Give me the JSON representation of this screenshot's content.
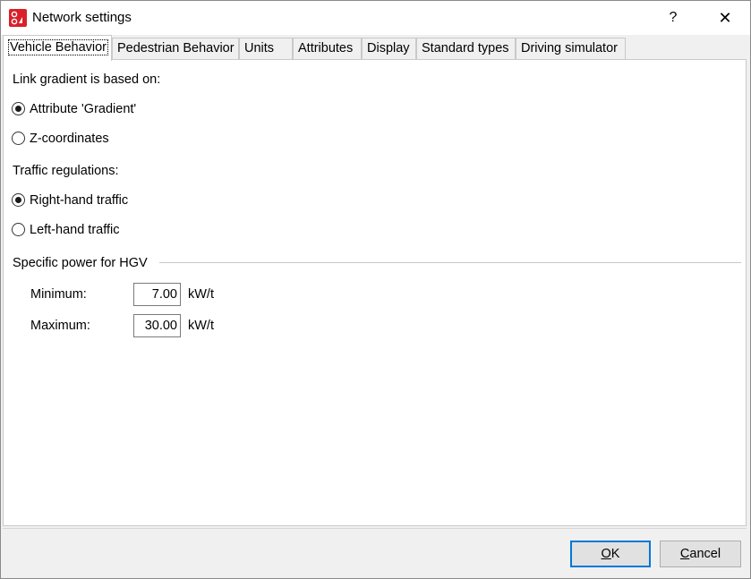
{
  "window": {
    "title": "Network settings",
    "help_label": "?",
    "close_label": "✕"
  },
  "tabs": [
    {
      "label": "Vehicle Behavior",
      "active": true
    },
    {
      "label": "Pedestrian Behavior"
    },
    {
      "label": "Units"
    },
    {
      "label": "Attributes"
    },
    {
      "label": "Display"
    },
    {
      "label": "Standard types"
    },
    {
      "label": "Driving simulator"
    }
  ],
  "gradient": {
    "heading": "Link gradient is based on:",
    "options": [
      {
        "label": "Attribute 'Gradient'",
        "checked": true
      },
      {
        "label": "Z-coordinates",
        "checked": false
      }
    ]
  },
  "traffic": {
    "heading": "Traffic regulations:",
    "options": [
      {
        "label": "Right-hand traffic",
        "checked": true
      },
      {
        "label": "Left-hand traffic",
        "checked": false
      }
    ]
  },
  "hgv": {
    "group_label": "Specific power for HGV",
    "minimum_label": "Minimum:",
    "minimum_value": "7.00",
    "maximum_label": "Maximum:",
    "maximum_value": "30.00",
    "unit": "kW/t"
  },
  "buttons": {
    "ok_mnemonic": "O",
    "ok_rest": "K",
    "cancel_mnemonic": "C",
    "cancel_rest": "ancel"
  },
  "colors": {
    "accent": "#0078d7",
    "app_icon_red": "#d9202a"
  }
}
